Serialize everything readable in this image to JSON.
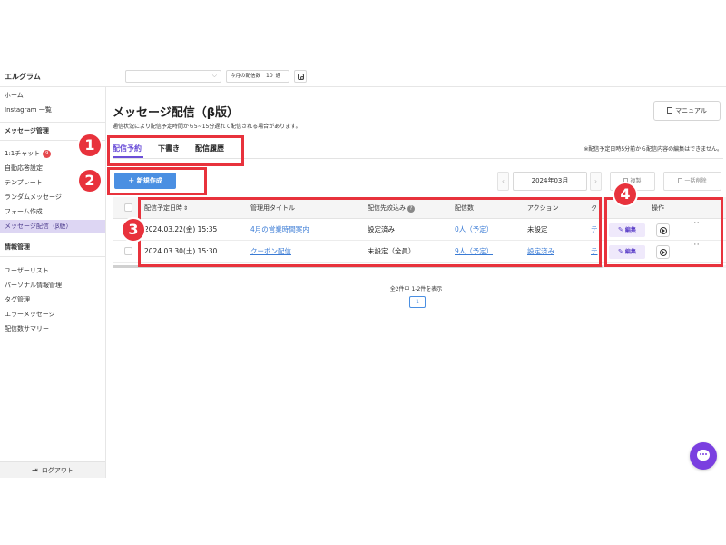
{
  "app": {
    "brand": "エルグラム"
  },
  "topbar": {
    "quota_label": "今月の配信数",
    "quota_value": "10",
    "quota_unit": "通",
    "instagram_icon": "instagram-icon"
  },
  "sidebar": {
    "item_home": "ホーム",
    "item_instagram": "Instagram 一覧",
    "section_message": "メッセージ管理",
    "chat_label": "1:1チャット",
    "chat_badge": "9",
    "item_auto": "自動応答設定",
    "item_template": "テンプレート",
    "item_random": "ランダムメッセージ",
    "item_form": "フォーム作成",
    "item_broadcast": "メッセージ配信（β版）",
    "section_info": "情報管理",
    "item_users": "ユーザーリスト",
    "item_personal": "パーソナル情報管理",
    "item_tags": "タグ管理",
    "item_errors": "エラーメッセージ",
    "item_summary": "配信数サマリー",
    "logout": "ログアウト"
  },
  "main": {
    "title": "メッセージ配信（β版）",
    "subtitle": "通信状況により配信予定時間から5~15分遅れて配信される場合があります。",
    "manual_label": "マニュアル",
    "tabs": [
      {
        "label": "配信予約"
      },
      {
        "label": "下書き"
      },
      {
        "label": "配信履歴"
      }
    ],
    "edit_note": "※配信予定日時5分前から配信内容の編集はできません。",
    "new_button": "＋ 新規作成",
    "month": "2024年03月",
    "copy_label": "複製",
    "bulk_delete_label": "一括削除",
    "table": {
      "headers": {
        "date": "配信予定日時",
        "title": "管理用タイトル",
        "filter": "配信先絞込み",
        "count": "配信数",
        "action": "アクション",
        "extra": "ク",
        "ops": "操作"
      },
      "rows": [
        {
          "date": "2024.03.22(金) 15:35",
          "title": "4月の営業時間案内",
          "filter": "設定済み",
          "count": "0人（予定）",
          "action": "未設定",
          "extra": "テ"
        },
        {
          "date": "2024.03.30(土) 15:30",
          "title": "クーポン配信",
          "filter": "未設定（全員）",
          "count": "9人（予定）",
          "action": "設定済み",
          "extra": "テ"
        }
      ],
      "edit_label": "編集",
      "more_label": "···"
    },
    "count_text": "全2件中 1-2件を表示",
    "page": "1"
  },
  "annotations": [
    "1",
    "2",
    "3",
    "4"
  ],
  "colors": {
    "accent": "#6b4fd8",
    "primary_button": "#4a8fe2",
    "annotation": "#e8323c",
    "chat_widget": "#7a3fe0"
  }
}
